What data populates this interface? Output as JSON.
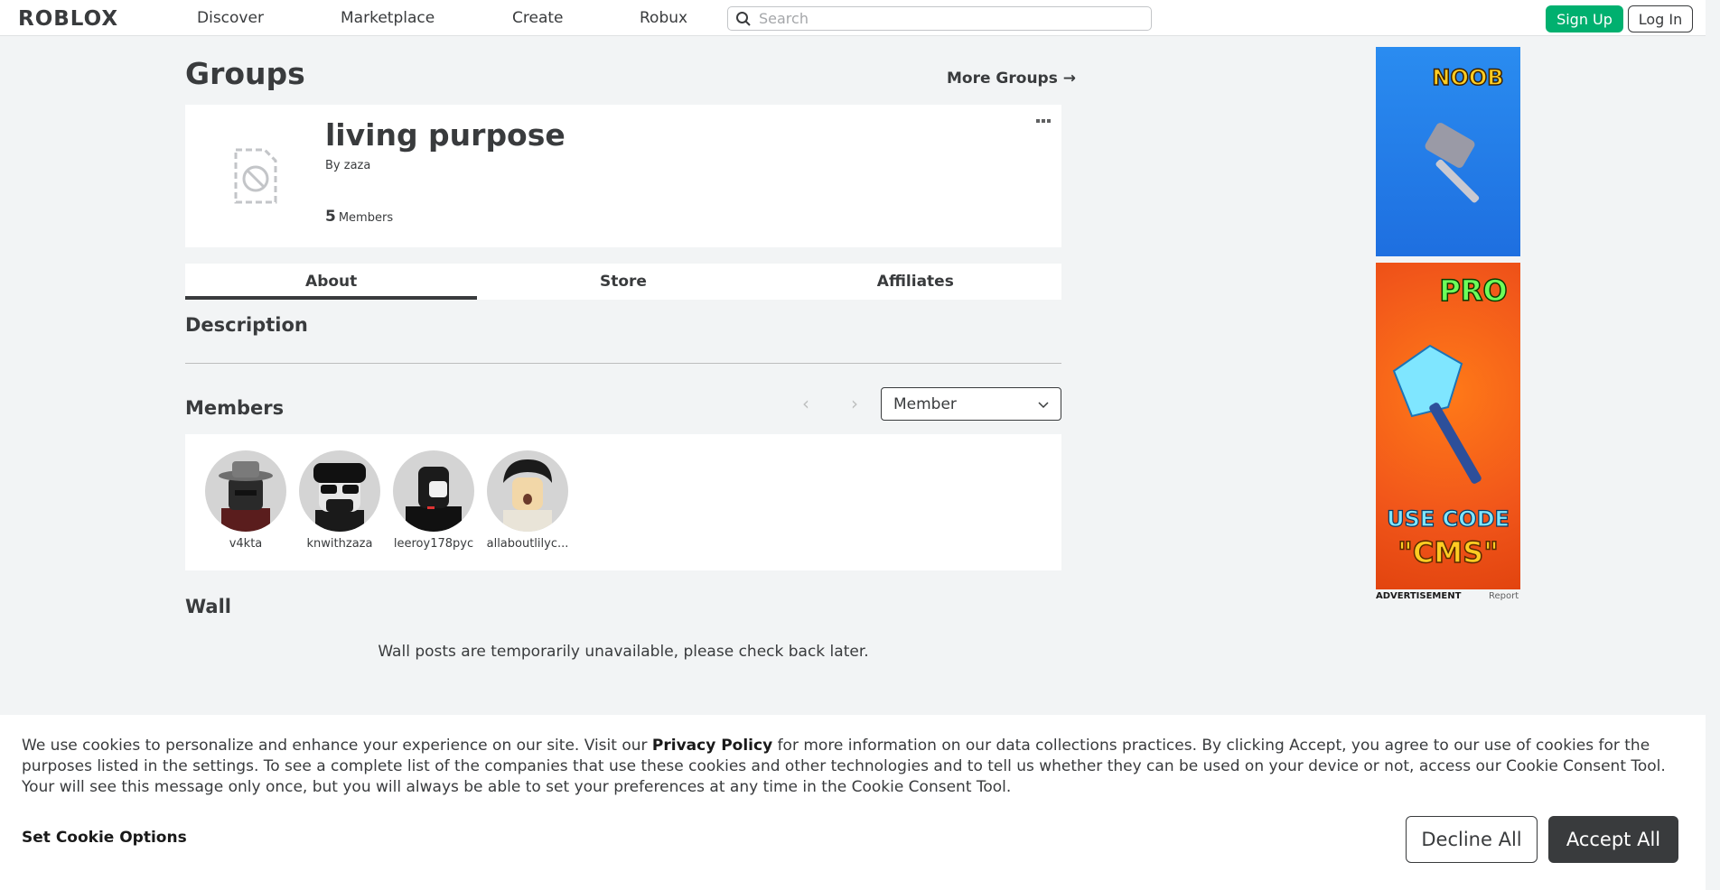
{
  "nav": {
    "logo": "ROBLOX",
    "links": [
      "Discover",
      "Marketplace",
      "Create",
      "Robux"
    ],
    "search_placeholder": "Search",
    "signup": "Sign Up",
    "login": "Log In"
  },
  "page": {
    "title": "Groups",
    "more_groups": "More Groups →"
  },
  "group": {
    "name": "living purpose",
    "by": "By zaza",
    "member_count": "5",
    "members_label": "Members"
  },
  "tabs": [
    "About",
    "Store",
    "Affiliates"
  ],
  "sections": {
    "description": "Description",
    "members": "Members",
    "wall": "Wall",
    "wall_message": "Wall posts are temporarily unavailable, please check back later."
  },
  "role_dropdown": {
    "selected": "Member"
  },
  "members": [
    {
      "name": "v4kta"
    },
    {
      "name": "knwithzaza"
    },
    {
      "name": "leeroy178pyc"
    },
    {
      "name": "allaboutlilyc..."
    }
  ],
  "ads": {
    "ad1_text": "NOOB",
    "ad2_top": "PRO",
    "ad2_line1": "USE CODE",
    "ad2_line2": "\"CMS\"",
    "label": "ADVERTISEMENT",
    "report": "Report"
  },
  "cookie": {
    "text_before": "We use cookies to personalize and enhance your experience on our site. Visit our ",
    "privacy_link": "Privacy Policy",
    "text_after": " for more information on our data collections practices. By clicking Accept, you agree to our use of cookies for the purposes listed in the settings. To see a complete list of the companies that use these cookies and other technologies and to tell us whether they can be used on your device or not, access our Cookie Consent Tool. Your will see this message only once, but you will always be able to set your preferences at any time in the Cookie Consent Tool.",
    "options": "Set Cookie Options",
    "decline": "Decline All",
    "accept": "Accept All"
  }
}
